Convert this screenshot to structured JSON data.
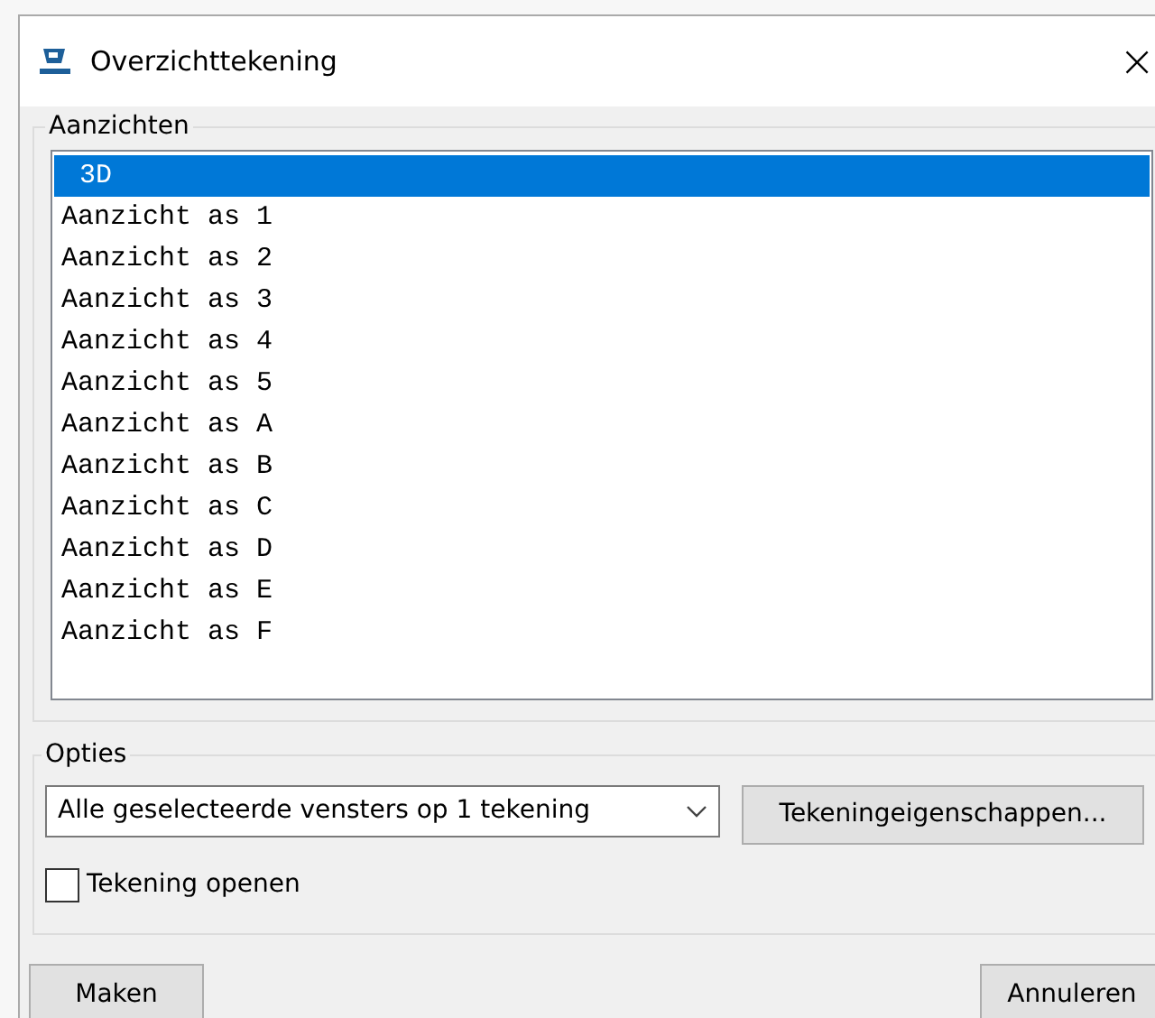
{
  "window": {
    "title": "Overzichttekening",
    "close": "×"
  },
  "views": {
    "label": "Aanzichten",
    "items": [
      {
        "label": "3D",
        "selected": true
      },
      {
        "label": "Aanzicht as 1",
        "selected": false
      },
      {
        "label": "Aanzicht as 2",
        "selected": false
      },
      {
        "label": "Aanzicht as 3",
        "selected": false
      },
      {
        "label": "Aanzicht as 4",
        "selected": false
      },
      {
        "label": "Aanzicht as 5",
        "selected": false
      },
      {
        "label": "Aanzicht as A",
        "selected": false
      },
      {
        "label": "Aanzicht as B",
        "selected": false
      },
      {
        "label": "Aanzicht as C",
        "selected": false
      },
      {
        "label": "Aanzicht as D",
        "selected": false
      },
      {
        "label": "Aanzicht as E",
        "selected": false
      },
      {
        "label": "Aanzicht as F",
        "selected": false
      }
    ]
  },
  "options": {
    "label": "Opties",
    "dropdown": {
      "value": "Alle geselecteerde vensters op 1 tekening"
    },
    "properties_button": "Tekeningeigenschappen...",
    "open_drawing": {
      "label": "Tekening openen",
      "checked": false
    }
  },
  "buttons": {
    "create": "Maken",
    "cancel": "Annuleren"
  }
}
